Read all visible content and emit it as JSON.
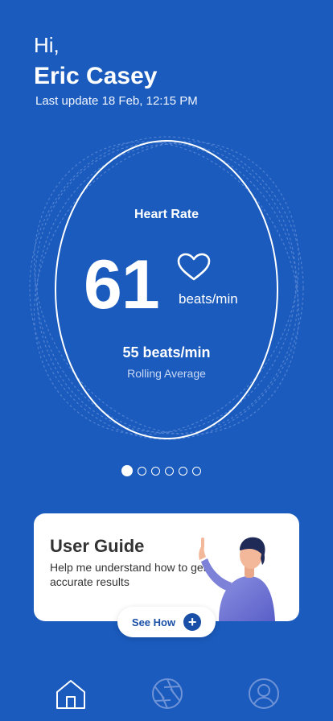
{
  "header": {
    "greeting": "Hi,",
    "username": "Eric Casey",
    "last_update": "Last update 18 Feb, 12:15 PM"
  },
  "heart_rate": {
    "title": "Heart Rate",
    "value": "61",
    "unit": "beats/min",
    "average_value": "55 beats/min",
    "average_label": "Rolling Average",
    "icon": "heart-icon"
  },
  "pager": {
    "count": 6,
    "active_index": 0
  },
  "guide": {
    "title": "User Guide",
    "description": "Help me understand how to get accurate results",
    "button_label": "See How",
    "button_icon": "plus-icon"
  },
  "nav": {
    "items": [
      {
        "icon": "home-icon",
        "active": true
      },
      {
        "icon": "camera-aperture-icon",
        "active": false
      },
      {
        "icon": "profile-icon",
        "active": false
      }
    ]
  },
  "colors": {
    "background": "#1a5bbd",
    "accent": "#1a4fa8",
    "card": "#ffffff"
  }
}
